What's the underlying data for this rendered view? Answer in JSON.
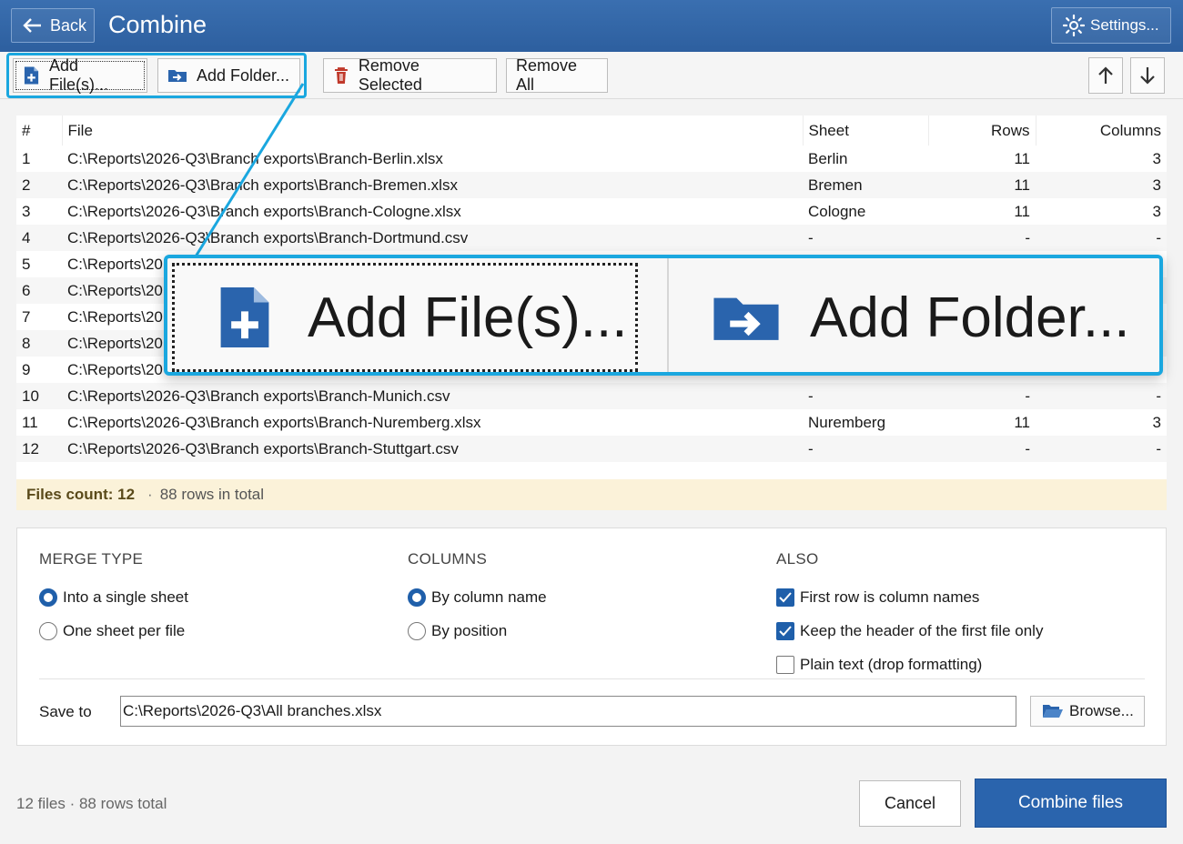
{
  "titlebar": {
    "back_label": "Back",
    "title": "Combine",
    "settings_label": "Settings..."
  },
  "toolbar": {
    "add_files_label": "Add File(s)...",
    "add_folder_label": "Add Folder...",
    "remove_selected_label": "Remove Selected",
    "remove_all_label": "Remove All"
  },
  "table": {
    "columns": [
      "#",
      "File",
      "Sheet",
      "Rows",
      "Columns"
    ],
    "rows": [
      {
        "n": "1",
        "file": "C:\\Reports\\2026-Q3\\Branch exports\\Branch-Berlin.xlsx",
        "sheet": "Berlin",
        "rows": "11",
        "cols": "3"
      },
      {
        "n": "2",
        "file": "C:\\Reports\\2026-Q3\\Branch exports\\Branch-Bremen.xlsx",
        "sheet": "Bremen",
        "rows": "11",
        "cols": "3"
      },
      {
        "n": "3",
        "file": "C:\\Reports\\2026-Q3\\Branch exports\\Branch-Cologne.xlsx",
        "sheet": "Cologne",
        "rows": "11",
        "cols": "3"
      },
      {
        "n": "4",
        "file": "C:\\Reports\\2026-Q3\\Branch exports\\Branch-Dortmund.csv",
        "sheet": "-",
        "rows": "-",
        "cols": "-"
      },
      {
        "n": "5",
        "file": "C:\\Reports\\20",
        "sheet": "",
        "rows": "",
        "cols": ""
      },
      {
        "n": "6",
        "file": "C:\\Reports\\20",
        "sheet": "",
        "rows": "",
        "cols": ""
      },
      {
        "n": "7",
        "file": "C:\\Reports\\20",
        "sheet": "",
        "rows": "",
        "cols": ""
      },
      {
        "n": "8",
        "file": "C:\\Reports\\20",
        "sheet": "",
        "rows": "",
        "cols": ""
      },
      {
        "n": "9",
        "file": "C:\\Reports\\20",
        "sheet": "",
        "rows": "",
        "cols": ""
      },
      {
        "n": "10",
        "file": "C:\\Reports\\2026-Q3\\Branch exports\\Branch-Munich.csv",
        "sheet": "-",
        "rows": "-",
        "cols": "-"
      },
      {
        "n": "11",
        "file": "C:\\Reports\\2026-Q3\\Branch exports\\Branch-Nuremberg.xlsx",
        "sheet": "Nuremberg",
        "rows": "11",
        "cols": "3"
      },
      {
        "n": "12",
        "file": "C:\\Reports\\2026-Q3\\Branch exports\\Branch-Stuttgart.csv",
        "sheet": "-",
        "rows": "-",
        "cols": "-"
      }
    ]
  },
  "status": {
    "files_count": "Files count: 12",
    "rows_total": "88 rows in total"
  },
  "zoom": {
    "add_files_label": "Add File(s)...",
    "add_folder_label": "Add Folder..."
  },
  "options": {
    "merge_type": {
      "heading": "MERGE TYPE",
      "single": "Into a single sheet",
      "per_file": "One sheet per file",
      "selected": "single"
    },
    "columns": {
      "heading": "COLUMNS",
      "by_name": "By column name",
      "by_position": "By position",
      "selected": "by_name"
    },
    "also": {
      "heading": "ALSO",
      "first_row": "First row is column names",
      "first_row_checked": true,
      "keep_header": "Keep the header of the first file only",
      "keep_header_checked": true,
      "plain_text": "Plain text (drop formatting)",
      "plain_text_checked": false
    },
    "save_to_label": "Save to",
    "save_to_value": "C:\\Reports\\2026-Q3\\All branches.xlsx",
    "browse_label": "Browse..."
  },
  "footer": {
    "summary": "12 files · 88 rows total",
    "cancel_label": "Cancel",
    "combine_label": "Combine files"
  },
  "colors": {
    "titlebar": "#2d5f9f",
    "accent": "#1f5faa",
    "highlight": "#1aa7df",
    "status_bg": "#fbf2d9"
  }
}
